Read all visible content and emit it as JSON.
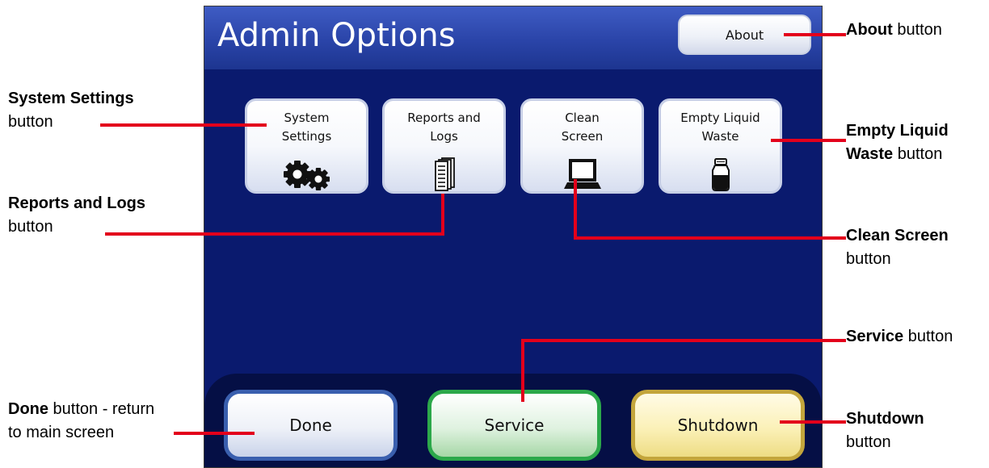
{
  "screen": {
    "title": "Admin Options",
    "about_label": "About",
    "tiles": [
      {
        "line1": "System",
        "line2": "Settings",
        "icon": "gears-icon"
      },
      {
        "line1": "Reports and",
        "line2": "Logs",
        "icon": "documents-icon"
      },
      {
        "line1": "Clean",
        "line2": "Screen",
        "icon": "computer-icon"
      },
      {
        "line1": "Empty Liquid",
        "line2": "Waste",
        "icon": "bottle-icon"
      }
    ],
    "footer": {
      "done_label": "Done",
      "service_label": "Service",
      "shutdown_label": "Shutdown"
    }
  },
  "callouts": {
    "system_settings": {
      "bold": "System Settings",
      "rest": "button"
    },
    "reports_logs": {
      "bold": "Reports and Logs",
      "rest": "button"
    },
    "done": {
      "bold": "Done",
      "rest": " button - return",
      "line2": "to main screen"
    },
    "about": {
      "bold": "About",
      "rest": " button"
    },
    "empty_waste": {
      "bold1": "Empty Liquid",
      "bold2": "Waste",
      "rest": " button"
    },
    "clean_screen": {
      "bold": "Clean Screen",
      "rest": "button"
    },
    "service": {
      "bold": "Service",
      "rest": " button"
    },
    "shutdown": {
      "bold": "Shutdown",
      "rest": "button"
    }
  },
  "colors": {
    "screen_bg": "#0a1a6e",
    "title_bar": "#2a44a8",
    "footer_bg": "#050f45",
    "leader_line": "#e3001b",
    "done_border": "#3a5fae",
    "service_border": "#2ca84a",
    "shutdown_border": "#c3a53c"
  }
}
